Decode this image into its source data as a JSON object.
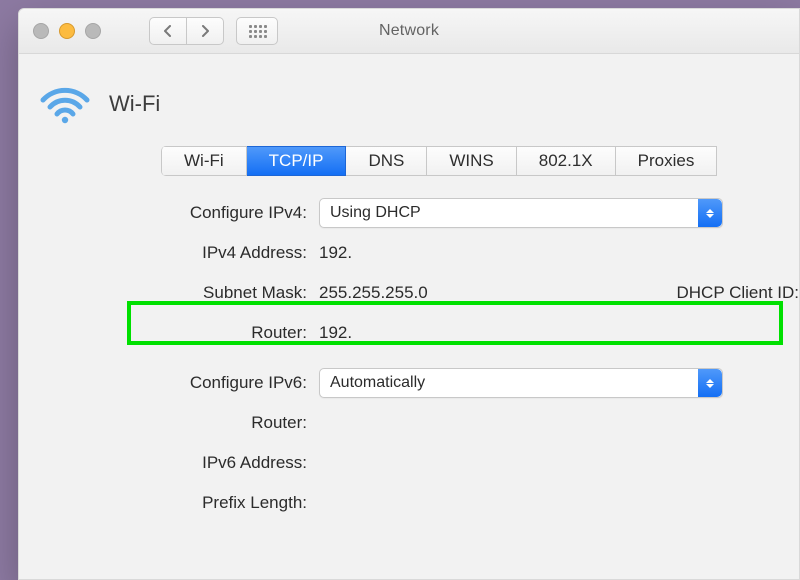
{
  "window": {
    "title": "Network"
  },
  "header": {
    "interface_name": "Wi-Fi"
  },
  "tabs": [
    {
      "label": "Wi-Fi"
    },
    {
      "label": "TCP/IP"
    },
    {
      "label": "DNS"
    },
    {
      "label": "WINS"
    },
    {
      "label": "802.1X"
    },
    {
      "label": "Proxies"
    }
  ],
  "labels": {
    "configure_ipv4": "Configure IPv4:",
    "ipv4_address": "IPv4 Address:",
    "subnet_mask": "Subnet Mask:",
    "router_v4": "Router:",
    "dhcp_client_id": "DHCP Client ID:",
    "configure_ipv6": "Configure IPv6:",
    "router_v6": "Router:",
    "ipv6_address": "IPv6 Address:",
    "prefix_length": "Prefix Length:"
  },
  "values": {
    "configure_ipv4": "Using DHCP",
    "ipv4_address": "192.",
    "subnet_mask": "255.255.255.0",
    "router_v4": "192.",
    "configure_ipv6": "Automatically",
    "router_v6": "",
    "ipv6_address": "",
    "prefix_length": ""
  }
}
